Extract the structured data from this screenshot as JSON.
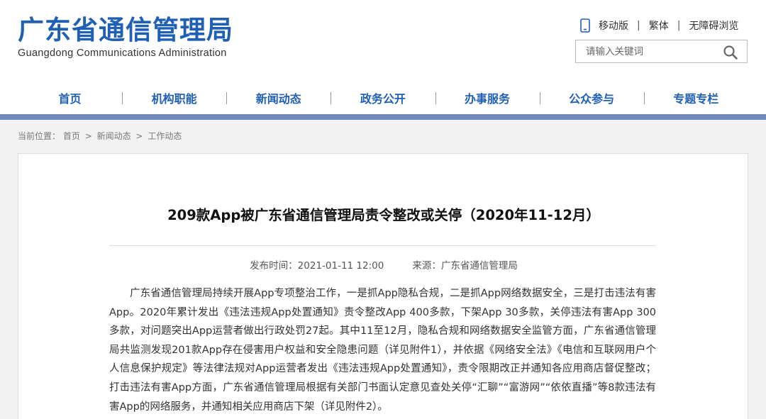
{
  "header": {
    "logo_cn": "广东省通信管理局",
    "logo_en": "Guangdong Communications Administration",
    "links": {
      "mobile": "移动版",
      "traditional": "繁体",
      "accessible": "无障碍浏览",
      "separator": "|"
    },
    "search": {
      "placeholder": "请输入关键词"
    }
  },
  "nav": [
    "首页",
    "机构职能",
    "新闻动态",
    "政务公开",
    "办事服务",
    "公众参与",
    "专题专栏"
  ],
  "breadcrumb": {
    "label": "当前位置：",
    "items": [
      "首页",
      "新闻动态",
      "工作动态"
    ],
    "arrow": ">"
  },
  "article": {
    "title": "209款App被广东省通信管理局责令整改或关停（2020年11-12月）",
    "published": "发布时间：2021-01-11 12:00",
    "source": "来源：广东省通信管理局",
    "body": "广东省通信管理局持续开展App专项整治工作，一是抓App隐私合规，二是抓App网络数据安全，三是打击违法有害App。2020年累计发出《违法违规App处置通知》责令整改App 400多款，下架App 30多款，关停违法有害App 300多款，对问题突出App运营者做出行政处罚27起。其中11至12月，隐私合规和网络数据安全监管方面，广东省通信管理局共监测发现201款App存在侵害用户权益和安全隐患问题（详见附件1），并依据《网络安全法》《电信和互联网用户个人信息保护规定》等法律法规对App运营者发出《违法违规App处置通知》，责令限期改正并通知各应用商店督促整改；打击违法有害App方面，广东省通信管理局根据有关部门书面认定意见查处关停“汇聊”“富游网”“依依直播”等8款违法有害App的网络服务，并通知相关应用商店下架（详见附件2）。"
  },
  "colors": {
    "brand_blue": "#1f5fb4",
    "bar_blue": "#6f8bbd"
  },
  "icons": {
    "mobile": "mobile-phone-icon",
    "search": "search-icon"
  }
}
